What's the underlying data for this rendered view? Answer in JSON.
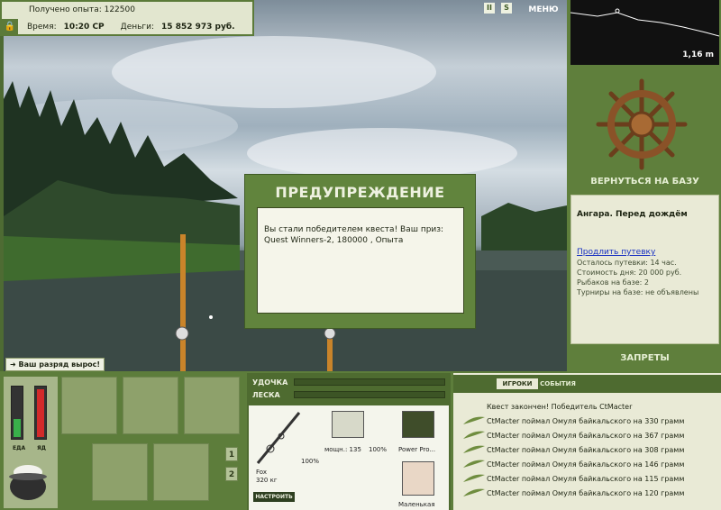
{
  "hud": {
    "experience": "Получено опыта: 122500",
    "time_label": "Время:",
    "time_value": "10:20 СР",
    "money_label": "Деньги:",
    "money_value": "15 852 973 руб.",
    "menu_label": "МЕНЮ",
    "pause_icon": "II",
    "sound_icon": "S"
  },
  "depth": {
    "value": "1,16 m"
  },
  "base": {
    "return_label": "ВЕРНУТЬСЯ НА БАЗУ",
    "location": "Ангара. Перед дождём",
    "extend_link": "Продлить путевку",
    "lines": [
      "Осталось путевки: 14 час.",
      "Стоимость дня: 20 000 руб.",
      "Рыбаков на базе: 2",
      "Турниры на базе: не объявлены"
    ],
    "bans_label": "ЗАПРЕТЫ"
  },
  "dialog": {
    "title": "ПРЕДУПРЕЖДЕНИЕ",
    "message": "Вы стали победителем квеста! Ваш приз: Quest Winners-2, 180000 , Опыта"
  },
  "rank_message": "Ваш разряд вырос!",
  "meters": {
    "food_label": "ЕДА",
    "health_label": "ЯД",
    "food_level": 0.35,
    "health_level": 0.95
  },
  "slots": {
    "page1": "1",
    "page2": "2"
  },
  "tackle": {
    "rod_label": "УДОЧКА",
    "line_label": "ЛЕСКА",
    "rod_name": "Fox",
    "rod_weight": "320 кг",
    "rod_percent": "100%",
    "reel_name": "мощн.: 135",
    "reel_percent": "100%",
    "line_name": "Power Pro...",
    "bait_name": "Маленькая",
    "setup_label": "НАСТРОИТЬ"
  },
  "events": {
    "tab_players": "ИГРОКИ",
    "tab_events": "СОБЫТИЯ",
    "header": "Квест закончен! Победитель CtMacter",
    "items": [
      "CtMacter поймал Омуля байкальского на 330 грамм",
      "CtMacter поймал Омуля байкальского на 367 грамм",
      "CtMacter поймал Омуля байкальского на 308 грамм",
      "CtMacter поймал Омуля байкальского на 146 грамм",
      "CtMacter поймал Омуля байкальского на 115 грамм",
      "CtMacter поймал Омуля байкальского на 120 грамм"
    ]
  },
  "colors": {
    "panel_green": "#5f7f3c",
    "paper": "#e9ead6",
    "link": "#1730c2"
  }
}
